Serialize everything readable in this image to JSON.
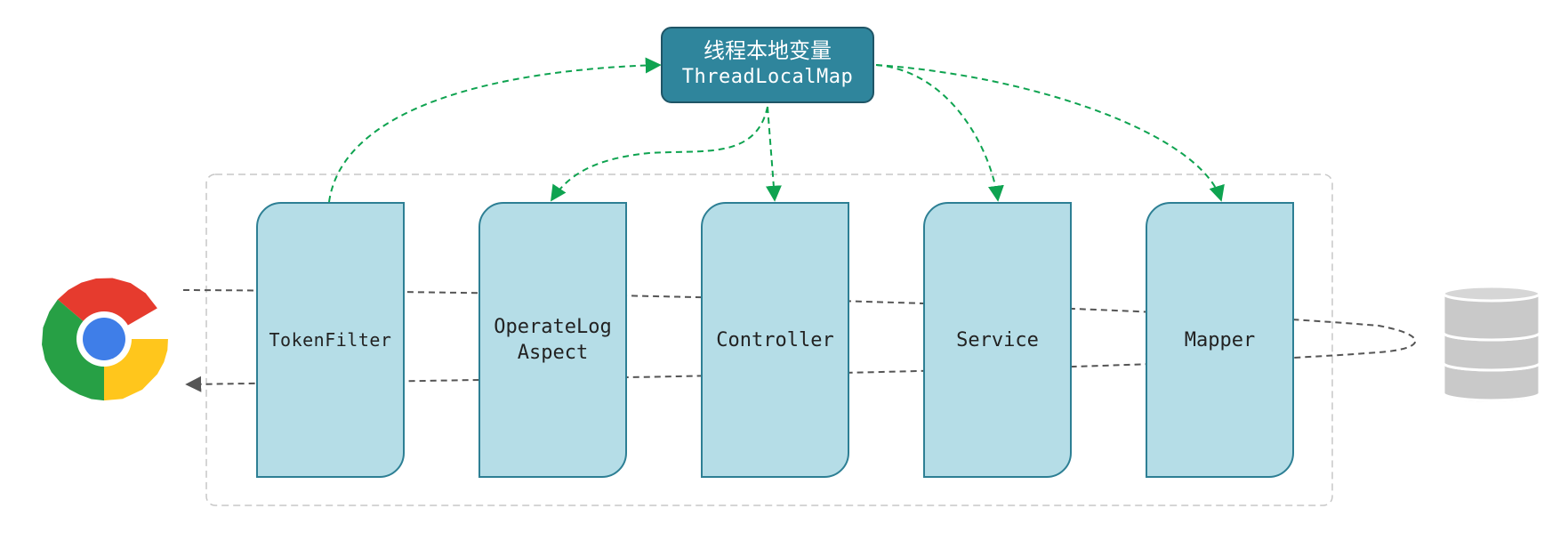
{
  "thread_local_box": {
    "line1": "线程本地变量",
    "line2": "ThreadLocalMap"
  },
  "layers": [
    {
      "label": "TokenFilter"
    },
    {
      "label_lines": [
        "OperateLog",
        "Aspect"
      ]
    },
    {
      "label": "Controller"
    },
    {
      "label": "Service"
    },
    {
      "label": "Mapper"
    }
  ],
  "icons": {
    "client": "chrome-browser-icon",
    "storage": "database-icon"
  },
  "colors": {
    "header_fill": "#2f859c",
    "layer_fill": "#b5dde7",
    "layer_border": "#2d7f94",
    "thread_flow": "#0ea350",
    "request_flow": "#555555",
    "container_border": "#c7c7c7"
  }
}
